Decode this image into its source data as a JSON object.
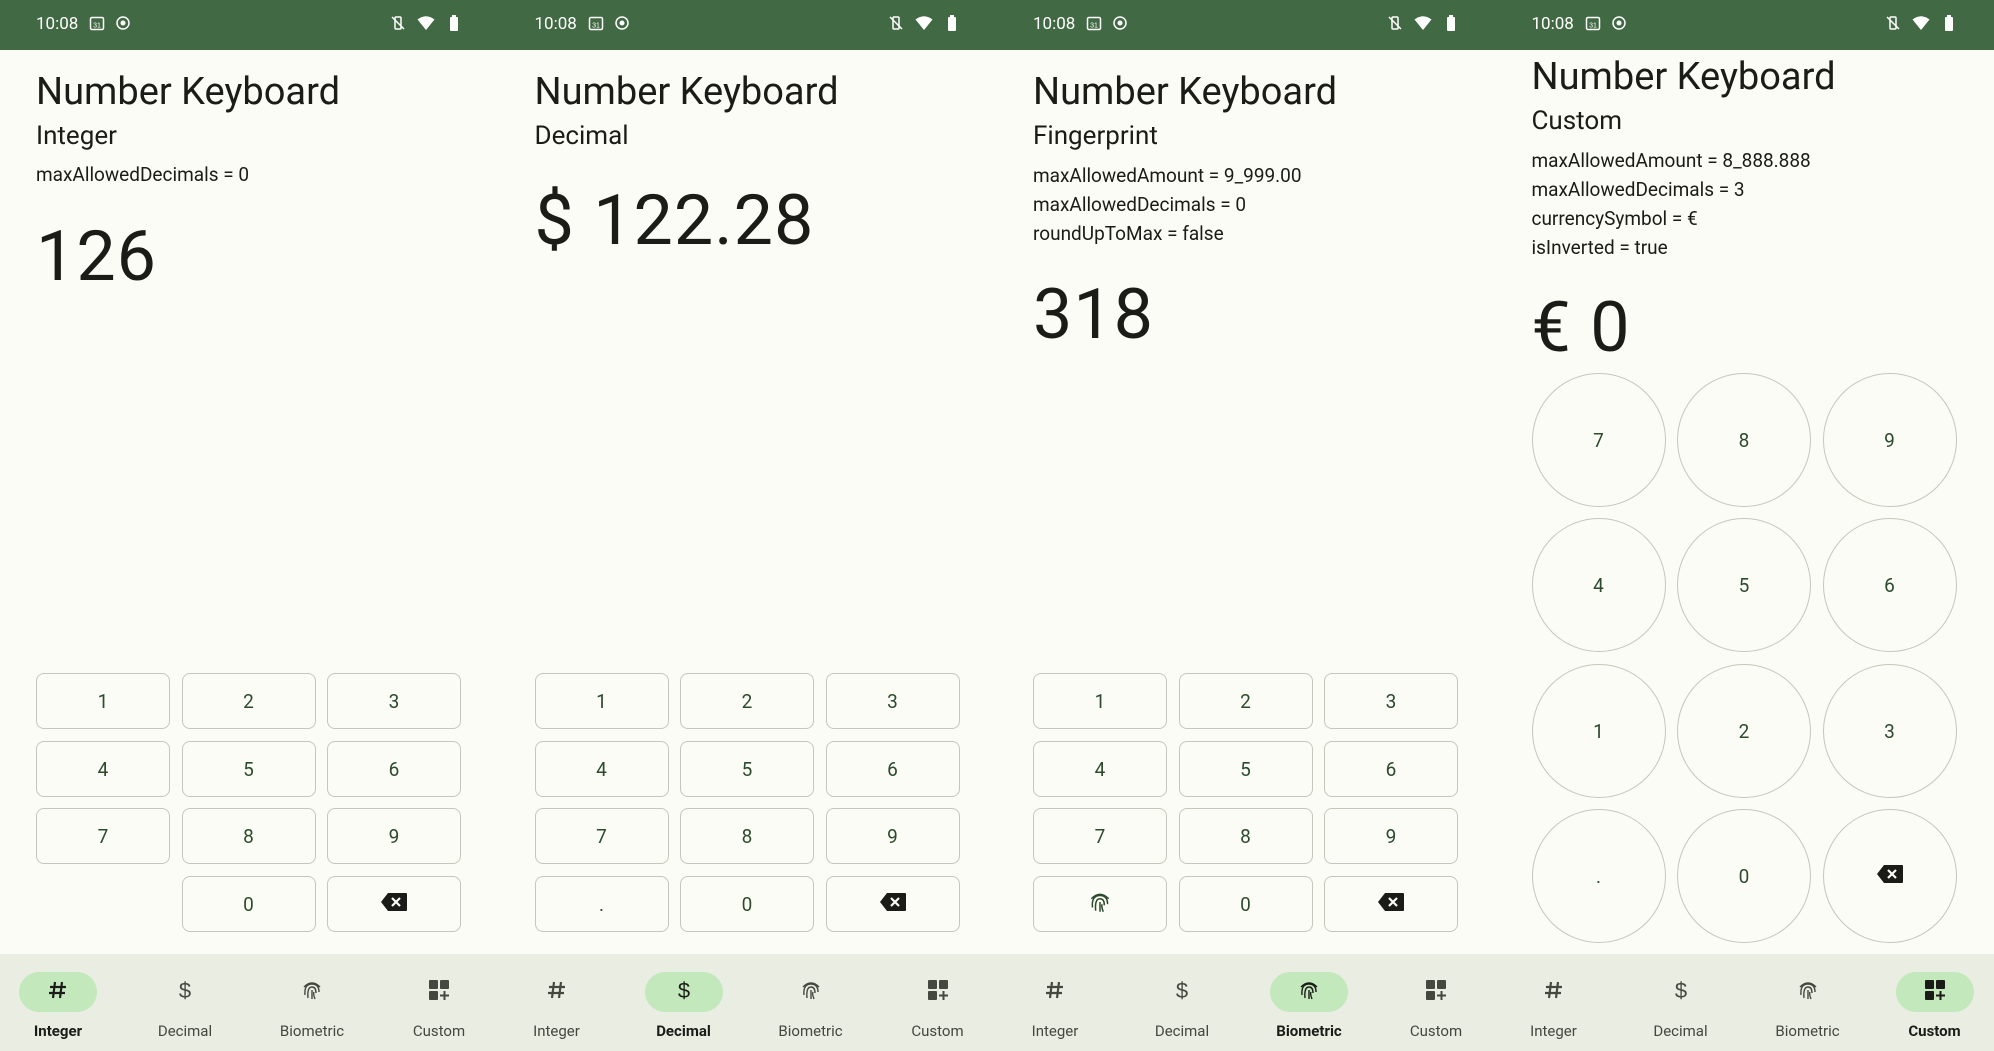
{
  "screens": [
    {
      "statusbar": {
        "time": "10:08",
        "calendar": "31"
      },
      "title": "Number Keyboard",
      "subtitle": "Integer",
      "info": [
        "maxAllowedDecimals = 0"
      ],
      "amount": "126",
      "keys": [
        "1",
        "2",
        "3",
        "4",
        "5",
        "6",
        "7",
        "8",
        "9",
        "",
        "0",
        "backspace-icon"
      ],
      "nav": [
        {
          "label": "Integer",
          "icon": "hash-icon",
          "active": true
        },
        {
          "label": "Decimal",
          "icon": "dollar-icon",
          "active": false
        },
        {
          "label": "Biometric",
          "icon": "fingerprint-icon",
          "active": false
        },
        {
          "label": "Custom",
          "icon": "widgets-icon",
          "active": false
        }
      ]
    },
    {
      "statusbar": {
        "time": "10:08",
        "calendar": "31"
      },
      "title": "Number Keyboard",
      "subtitle": "Decimal",
      "info": [],
      "amount": "$ 122.28",
      "keys": [
        "1",
        "2",
        "3",
        "4",
        "5",
        "6",
        "7",
        "8",
        "9",
        ".",
        "0",
        "backspace-icon"
      ],
      "nav": [
        {
          "label": "Integer",
          "icon": "hash-icon",
          "active": false
        },
        {
          "label": "Decimal",
          "icon": "dollar-icon",
          "active": true
        },
        {
          "label": "Biometric",
          "icon": "fingerprint-icon",
          "active": false
        },
        {
          "label": "Custom",
          "icon": "widgets-icon",
          "active": false
        }
      ]
    },
    {
      "statusbar": {
        "time": "10:08",
        "calendar": "31"
      },
      "title": "Number Keyboard",
      "subtitle": "Fingerprint",
      "info": [
        "maxAllowedAmount = 9_999.00",
        "maxAllowedDecimals = 0",
        "roundUpToMax = false"
      ],
      "amount": "318",
      "keys": [
        "1",
        "2",
        "3",
        "4",
        "5",
        "6",
        "7",
        "8",
        "9",
        "fingerprint-icon",
        "0",
        "backspace-icon"
      ],
      "nav": [
        {
          "label": "Integer",
          "icon": "hash-icon",
          "active": false
        },
        {
          "label": "Decimal",
          "icon": "dollar-icon",
          "active": false
        },
        {
          "label": "Biometric",
          "icon": "fingerprint-icon",
          "active": true
        },
        {
          "label": "Custom",
          "icon": "widgets-icon",
          "active": false
        }
      ]
    },
    {
      "statusbar": {
        "time": "10:08",
        "calendar": "31"
      },
      "title": "Number Keyboard",
      "subtitle": "Custom",
      "info": [
        "maxAllowedAmount = 8_888.888",
        "maxAllowedDecimals = 3",
        "currencySymbol = €",
        "isInverted = true"
      ],
      "amount": "€ 0",
      "keys": [
        "7",
        "8",
        "9",
        "4",
        "5",
        "6",
        "1",
        "2",
        "3",
        ".",
        "0",
        "backspace-icon"
      ],
      "nav": [
        {
          "label": "Integer",
          "icon": "hash-icon",
          "active": false
        },
        {
          "label": "Decimal",
          "icon": "dollar-icon",
          "active": false
        },
        {
          "label": "Biometric",
          "icon": "fingerprint-icon",
          "active": false
        },
        {
          "label": "Custom",
          "icon": "widgets-icon",
          "active": true
        }
      ]
    }
  ]
}
